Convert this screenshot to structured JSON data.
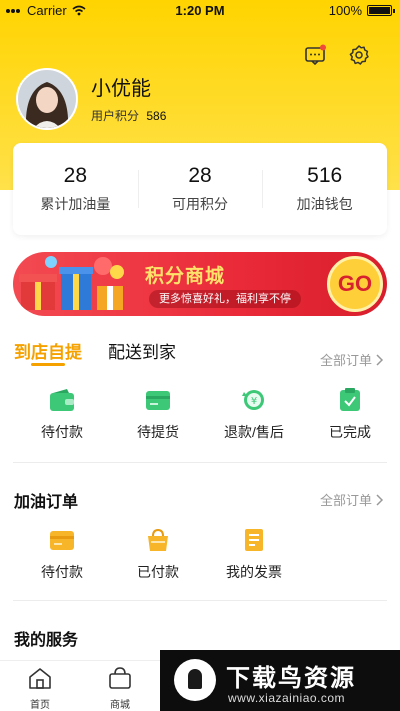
{
  "status_bar": {
    "carrier": "Carrier",
    "time": "1:20 PM",
    "battery": "100%"
  },
  "header": {
    "message_icon": "message-icon",
    "settings_icon": "gear-icon"
  },
  "user": {
    "name": "小优能",
    "points_label": "用户积分",
    "points_value": "586"
  },
  "stats": [
    {
      "value": "28",
      "label": "累计加油量"
    },
    {
      "value": "28",
      "label": "可用积分"
    },
    {
      "value": "516",
      "label": "加油钱包"
    }
  ],
  "banner": {
    "title": "积分商城",
    "subtitle": "更多惊喜好礼，福利享不停",
    "go": "GO"
  },
  "pickup_section": {
    "tabs": [
      {
        "label": "到店自提"
      },
      {
        "label": "配送到家"
      }
    ],
    "all_orders": "全部订单",
    "items": [
      {
        "label": "待付款",
        "icon": "wallet-icon",
        "color": "#3dc877"
      },
      {
        "label": "待提货",
        "icon": "card-icon",
        "color": "#3dc877"
      },
      {
        "label": "退款/售后",
        "icon": "refund-icon",
        "color": "#3dc877"
      },
      {
        "label": "已完成",
        "icon": "done-icon",
        "color": "#3dc877"
      }
    ]
  },
  "fuel_section": {
    "title": "加油订单",
    "all_orders": "全部订单",
    "items": [
      {
        "label": "待付款",
        "icon": "card-icon",
        "color": "#f7b52a"
      },
      {
        "label": "已付款",
        "icon": "bag-icon",
        "color": "#f7b52a"
      },
      {
        "label": "我的发票",
        "icon": "invoice-icon",
        "color": "#f7b52a"
      }
    ]
  },
  "services_section": {
    "title": "我的服务"
  },
  "tabbar": [
    {
      "label": "首页",
      "icon": "home-icon"
    },
    {
      "label": "商城",
      "icon": "shop-bag-icon"
    }
  ],
  "watermark": {
    "title": "下载鸟资源",
    "url": "www.xiazainiao.com"
  },
  "colors": {
    "brand_yellow": "#ffd400",
    "accent_orange": "#f5a200",
    "green": "#3dc877",
    "red": "#ea2a38"
  }
}
